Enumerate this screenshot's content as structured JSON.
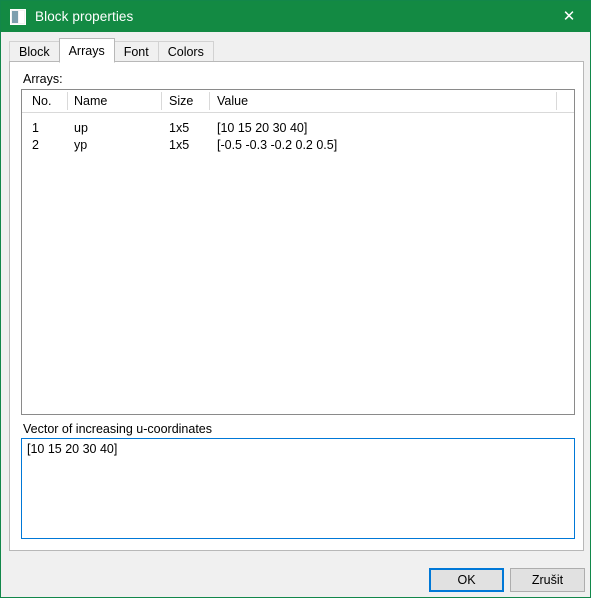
{
  "window": {
    "title": "Block properties",
    "icon": "window-properties-icon",
    "close_label": "✕",
    "border_color": "#12874a",
    "titlebar_color": "#138a43",
    "background_color": "#f0f0f0"
  },
  "tabs": [
    {
      "label": "Block",
      "active": false
    },
    {
      "label": "Arrays",
      "active": true
    },
    {
      "label": "Font",
      "active": false
    },
    {
      "label": "Colors",
      "active": false
    }
  ],
  "arrays_tab": {
    "list_label": "Arrays:",
    "columns": [
      "No.",
      "Name",
      "Size",
      "Value"
    ],
    "rows": [
      {
        "no": "1",
        "name": "up",
        "size": "1x5",
        "value": "[10 15 20 30 40]"
      },
      {
        "no": "2",
        "name": "yp",
        "size": "1x5",
        "value": "[-0.5 -0.3 -0.2 0.2 0.5]"
      }
    ],
    "editor": {
      "label": "Vector of increasing u-coordinates",
      "value": "[10 15 20 30 40]",
      "focus_color": "#0078d7"
    }
  },
  "footer": {
    "ok_label": "OK",
    "cancel_label": "Zrušit",
    "focus_color": "#0078d7"
  }
}
